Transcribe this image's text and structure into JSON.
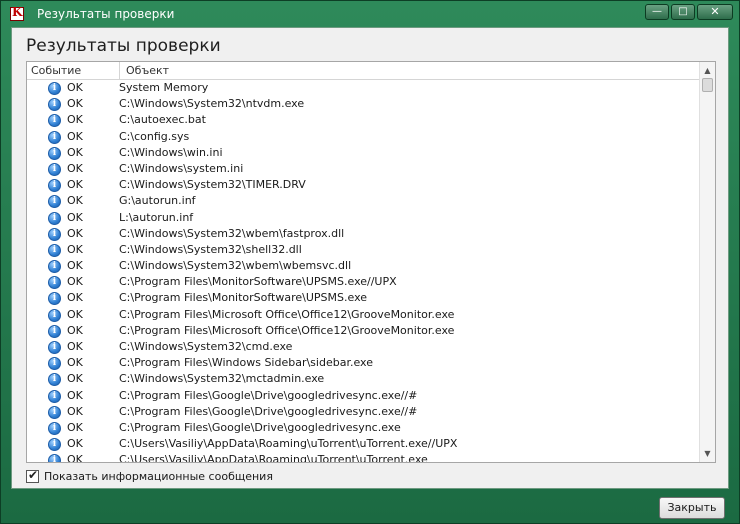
{
  "window": {
    "title": "Результаты проверки",
    "app_icon_letter": "K",
    "minimize_glyph": "—",
    "maximize_glyph": "□",
    "close_glyph": "✕"
  },
  "main": {
    "heading": "Результаты проверки",
    "columns": [
      "Событие",
      "Объект"
    ],
    "rows": [
      {
        "event": "OK",
        "object": "System Memory"
      },
      {
        "event": "OK",
        "object": "C:\\Windows\\System32\\ntvdm.exe"
      },
      {
        "event": "OK",
        "object": "C:\\autoexec.bat"
      },
      {
        "event": "OK",
        "object": "C:\\config.sys"
      },
      {
        "event": "OK",
        "object": "C:\\Windows\\win.ini"
      },
      {
        "event": "OK",
        "object": "C:\\Windows\\system.ini"
      },
      {
        "event": "OK",
        "object": "C:\\Windows\\System32\\TIMER.DRV"
      },
      {
        "event": "OK",
        "object": "G:\\autorun.inf"
      },
      {
        "event": "OK",
        "object": "L:\\autorun.inf"
      },
      {
        "event": "OK",
        "object": "C:\\Windows\\System32\\wbem\\fastprox.dll"
      },
      {
        "event": "OK",
        "object": "C:\\Windows\\System32\\shell32.dll"
      },
      {
        "event": "OK",
        "object": "C:\\Windows\\System32\\wbem\\wbemsvc.dll"
      },
      {
        "event": "OK",
        "object": "C:\\Program Files\\MonitorSoftware\\UPSMS.exe//UPX"
      },
      {
        "event": "OK",
        "object": "C:\\Program Files\\MonitorSoftware\\UPSMS.exe"
      },
      {
        "event": "OK",
        "object": "C:\\Program Files\\Microsoft Office\\Office12\\GrooveMonitor.exe"
      },
      {
        "event": "OK",
        "object": "C:\\Program Files\\Microsoft Office\\Office12\\GrooveMonitor.exe"
      },
      {
        "event": "OK",
        "object": "C:\\Windows\\System32\\cmd.exe"
      },
      {
        "event": "OK",
        "object": "C:\\Program Files\\Windows Sidebar\\sidebar.exe"
      },
      {
        "event": "OK",
        "object": "C:\\Windows\\System32\\mctadmin.exe"
      },
      {
        "event": "OK",
        "object": "C:\\Program Files\\Google\\Drive\\googledrivesync.exe//#"
      },
      {
        "event": "OK",
        "object": "C:\\Program Files\\Google\\Drive\\googledrivesync.exe//#"
      },
      {
        "event": "OK",
        "object": "C:\\Program Files\\Google\\Drive\\googledrivesync.exe"
      },
      {
        "event": "OK",
        "object": "C:\\Users\\Vasiliy\\AppData\\Roaming\\uTorrent\\uTorrent.exe//UPX"
      },
      {
        "event": "OK",
        "object": "C:\\Users\\Vasiliy\\AppData\\Roaming\\uTorrent\\uTorrent.exe"
      }
    ],
    "info_icon_glyph": "i",
    "show_info_label": "Показать информационные сообщения",
    "show_info_checked": true,
    "checkmark_glyph": "✔"
  },
  "footer": {
    "close_label": "Закрыть"
  },
  "colors": {
    "frame": "#2e8a5a",
    "info_icon": "#2f7fd3"
  }
}
